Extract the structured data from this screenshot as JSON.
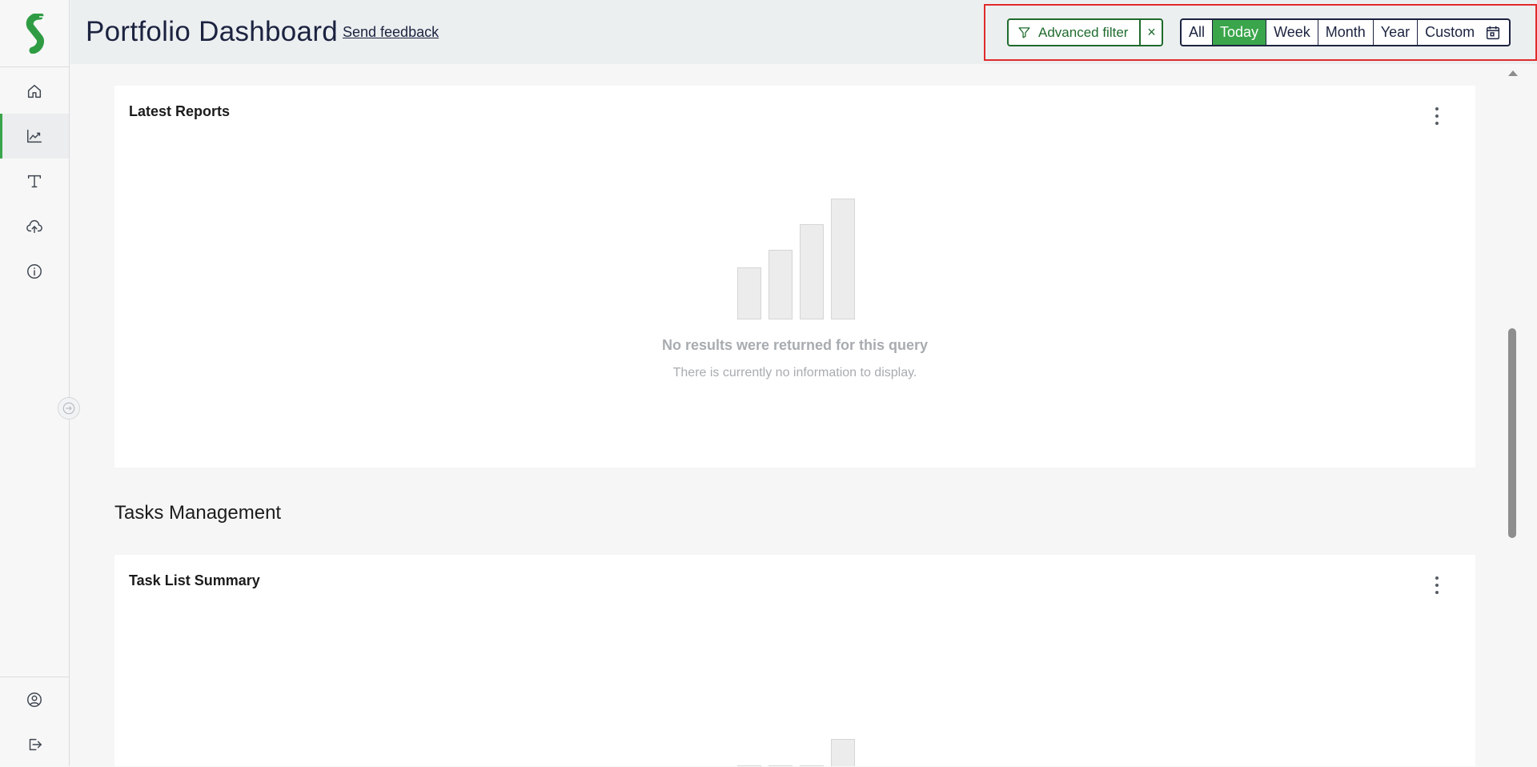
{
  "header": {
    "title": "Portfolio Dashboard",
    "feedback_label": "Send feedback",
    "advanced_filter_label": "Advanced filter",
    "clear_filter_label": "×",
    "period_options": [
      "All",
      "Today",
      "Week",
      "Month",
      "Year",
      "Custom"
    ],
    "selected_period": "Today"
  },
  "sidebar": {
    "items": [
      {
        "icon": "home-icon"
      },
      {
        "icon": "trending-chart-icon",
        "active": true
      },
      {
        "icon": "text-format-icon"
      },
      {
        "icon": "cloud-upload-icon"
      },
      {
        "icon": "info-icon"
      }
    ],
    "bottom_items": [
      {
        "icon": "user-circle-icon"
      },
      {
        "icon": "logout-icon"
      }
    ]
  },
  "main": {
    "latest_reports": {
      "title": "Latest Reports",
      "empty_title": "No results were returned for this query",
      "empty_subtitle": "There is currently no information to display."
    },
    "tasks_section_title": "Tasks Management",
    "task_list_summary": {
      "title": "Task List Summary"
    }
  },
  "colors": {
    "accent_green": "#3aa54b",
    "dark_navy": "#1c2340",
    "filter_green": "#1f6b2d",
    "highlight_red": "#e02b2b"
  }
}
